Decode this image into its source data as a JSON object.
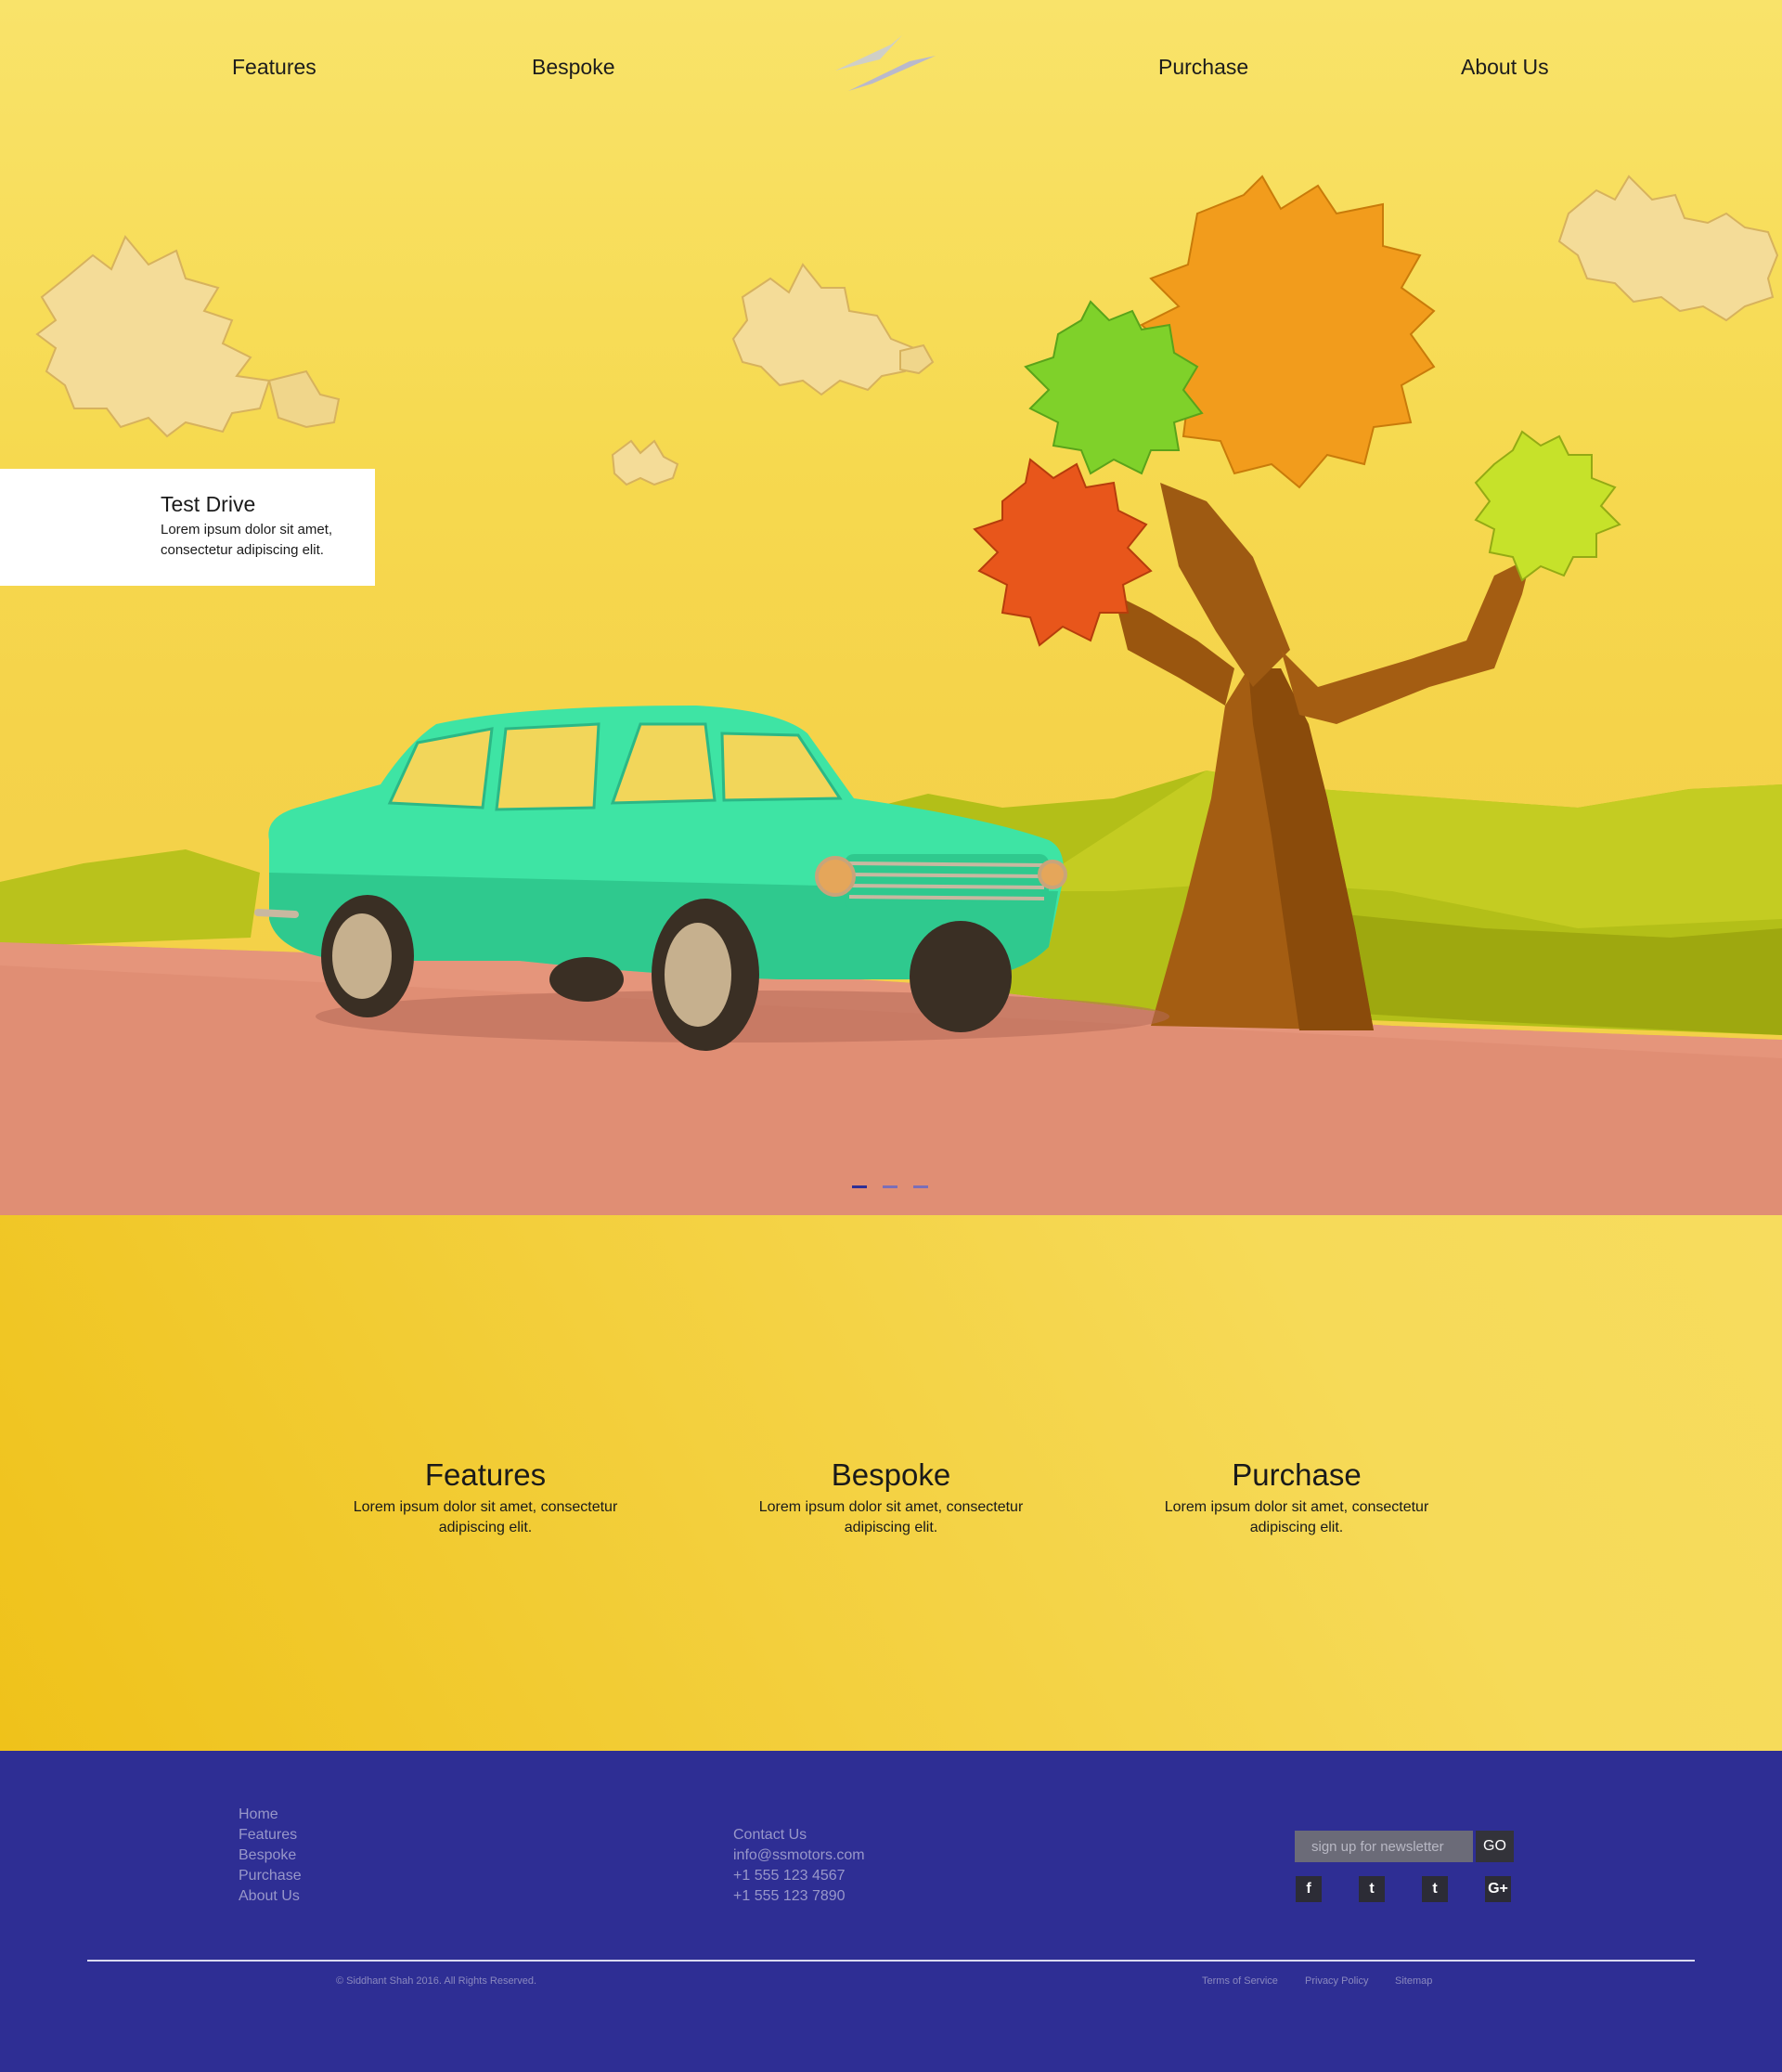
{
  "nav": {
    "features": "Features",
    "bespoke": "Bespoke",
    "purchase": "Purchase",
    "about": "About Us",
    "logo_icon": "lightning-bolt-logo-icon"
  },
  "hero": {
    "testdrive_title": "Test Drive",
    "testdrive_text": "Lorem ipsum dolor sit amet, consectetur adipiscing elit.",
    "slide_count": 3,
    "active_slide": 1,
    "colors": {
      "sky": "#f6d94f",
      "road": "#e08e74",
      "car": "#3ee4a4",
      "hills": "#b7c218",
      "trunk": "#a45d12"
    }
  },
  "features": [
    {
      "title": "Features",
      "text": "Lorem ipsum dolor sit amet, consectetur adipiscing elit."
    },
    {
      "title": "Bespoke",
      "text": "Lorem ipsum dolor sit amet, consectetur adipiscing elit."
    },
    {
      "title": "Purchase",
      "text": "Lorem ipsum dolor sit amet, consectetur adipiscing elit."
    }
  ],
  "footer": {
    "links": [
      "Home",
      "Features",
      "Bespoke",
      "Purchase",
      "About Us"
    ],
    "contact_title": "Contact Us",
    "email": "info@ssmotors.com",
    "phone1": "+1 555 123 4567",
    "phone2": "+1 555 123 7890",
    "newsletter_placeholder": "sign up for newsletter",
    "go_label": "GO",
    "social": {
      "facebook": "f",
      "twitter": "t",
      "google_plus": "G+"
    },
    "copyright": "© Siddhant Shah 2016. All Rights Reserved.",
    "terms": "Terms of Service",
    "privacy": "Privacy Policy",
    "sitemap": "Sitemap",
    "background": "#2e2e94"
  }
}
